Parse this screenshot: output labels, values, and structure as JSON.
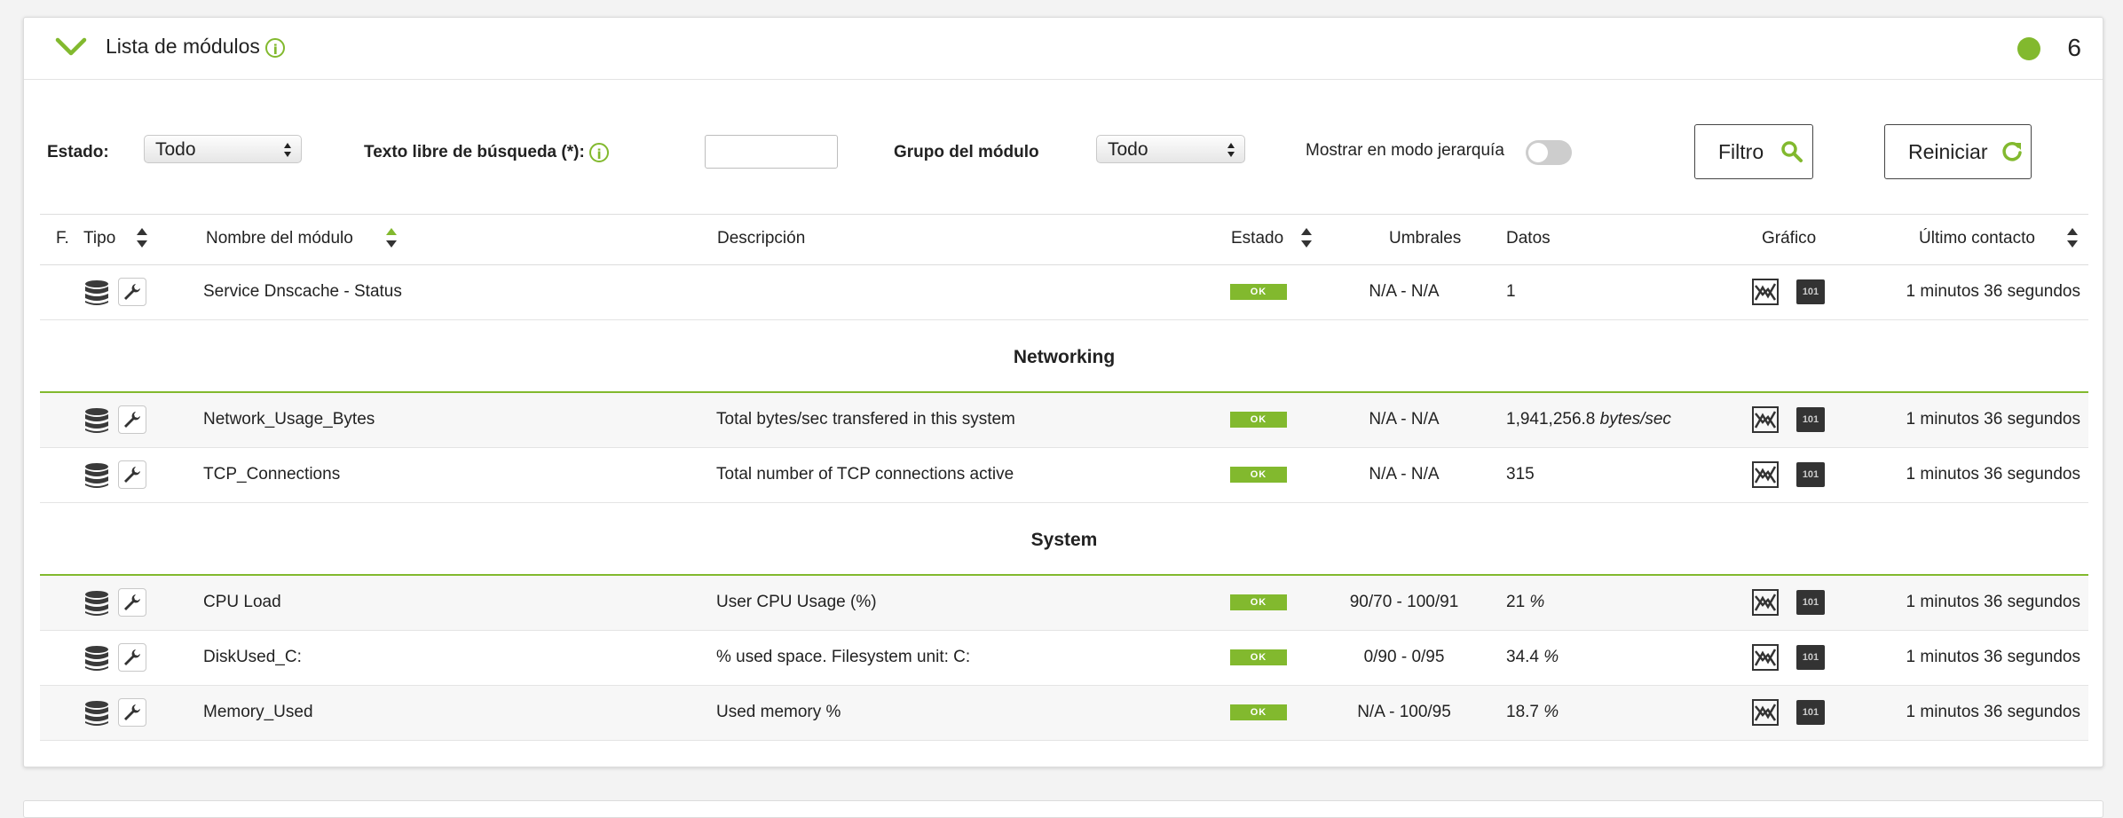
{
  "header": {
    "title": "Lista de módulos",
    "count": "6",
    "status_color": "#82b92e"
  },
  "filters": {
    "estado_label": "Estado:",
    "estado_value": "Todo",
    "search_label": "Texto libre de búsqueda (*):",
    "search_value": "",
    "grupo_label": "Grupo del módulo",
    "grupo_value": "Todo",
    "hierarchy_label": "Mostrar en modo jerarquía",
    "filter_button": "Filtro",
    "reset_button": "Reiniciar"
  },
  "table": {
    "columns": {
      "f": "F.",
      "tipo": "Tipo",
      "nombre": "Nombre del módulo",
      "descripcion": "Descripción",
      "estado": "Estado",
      "umbrales": "Umbrales",
      "datos": "Datos",
      "grafico": "Gráfico",
      "contacto": "Último contacto"
    },
    "ungrouped": [
      {
        "name": "Service Dnscache - Status",
        "description": "",
        "status": "OK",
        "thresholds": "N/A - N/A",
        "data": "1",
        "unit": "",
        "last_contact": "1 minutos 36 segundos"
      }
    ],
    "groups": [
      {
        "title": "Networking",
        "rows": [
          {
            "name": "Network_Usage_Bytes",
            "description": "Total bytes/sec transfered in this system",
            "status": "OK",
            "thresholds": "N/A - N/A",
            "data": "1,941,256.8",
            "unit": "bytes/sec",
            "last_contact": "1 minutos 36 segundos"
          },
          {
            "name": "TCP_Connections",
            "description": "Total number of TCP connections active",
            "status": "OK",
            "thresholds": "N/A - N/A",
            "data": "315",
            "unit": "",
            "last_contact": "1 minutos 36 segundos"
          }
        ]
      },
      {
        "title": "System",
        "rows": [
          {
            "name": "CPU Load",
            "description": "User CPU Usage (%)",
            "status": "OK",
            "thresholds": "90/70 - 100/91",
            "data": "21",
            "unit": "%",
            "last_contact": "1 minutos 36 segundos"
          },
          {
            "name": "DiskUsed_C:",
            "description": "% used space. Filesystem unit: C:",
            "status": "OK",
            "thresholds": "0/90 - 0/95",
            "data": "34.4",
            "unit": "%",
            "last_contact": "1 minutos 36 segundos"
          },
          {
            "name": "Memory_Used",
            "description": "Used memory %",
            "status": "OK",
            "thresholds": "N/A - 100/95",
            "data": "18.7",
            "unit": "%",
            "last_contact": "1 minutos 36 segundos"
          }
        ]
      }
    ],
    "binary_icon_label": "101"
  }
}
